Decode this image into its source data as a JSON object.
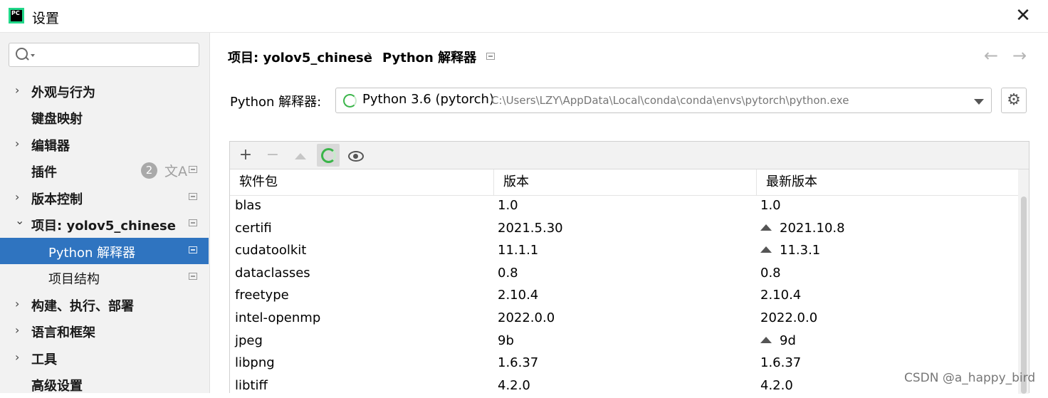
{
  "window": {
    "title": "设置",
    "logo_text": "PC",
    "close_glyph": "✕"
  },
  "sidebar": {
    "search": {
      "value": "",
      "placeholder": ""
    },
    "items": [
      {
        "label": "外观与行为",
        "expandable": true
      },
      {
        "label": "键盘映射",
        "expandable": false
      },
      {
        "label": "编辑器",
        "expandable": true
      },
      {
        "label": "插件",
        "expandable": false,
        "badge": "2"
      },
      {
        "label": "版本控制",
        "expandable": true
      },
      {
        "label": "项目: yolov5_chinese",
        "expandable": true,
        "expanded": true
      },
      {
        "label": "Python 解释器",
        "sub": true,
        "selected": true
      },
      {
        "label": "项目结构",
        "sub": true
      },
      {
        "label": "构建、执行、部署",
        "expandable": true
      },
      {
        "label": "语言和框架",
        "expandable": true
      },
      {
        "label": "工具",
        "expandable": true
      },
      {
        "label": "高级设置",
        "expandable": false
      }
    ],
    "chevron_right": "›",
    "chevron_down": "⌄",
    "translate_glyph": "文A"
  },
  "breadcrumb": {
    "project": "项目: yolov5_chinese",
    "separator": "›",
    "page": "Python 解释器",
    "back_glyph": "←",
    "forward_glyph": "→"
  },
  "interpreter": {
    "label": "Python 解释器:",
    "name": "Python 3.6 (pytorch)",
    "path": "C:\\Users\\LZY\\AppData\\Local\\conda\\conda\\envs\\pytorch\\python.exe",
    "gear_glyph": "⚙"
  },
  "toolbar": {
    "add_glyph": "+",
    "remove_glyph": "−"
  },
  "table": {
    "columns": [
      "软件包",
      "版本",
      "最新版本"
    ],
    "rows": [
      {
        "name": "blas",
        "version": "1.0",
        "latest": "1.0",
        "upgrade": false
      },
      {
        "name": "certifi",
        "version": "2021.5.30",
        "latest": "2021.10.8",
        "upgrade": true
      },
      {
        "name": "cudatoolkit",
        "version": "11.1.1",
        "latest": "11.3.1",
        "upgrade": true
      },
      {
        "name": "dataclasses",
        "version": "0.8",
        "latest": "0.8",
        "upgrade": false
      },
      {
        "name": "freetype",
        "version": "2.10.4",
        "latest": "2.10.4",
        "upgrade": false
      },
      {
        "name": "intel-openmp",
        "version": "2022.0.0",
        "latest": "2022.0.0",
        "upgrade": false
      },
      {
        "name": "jpeg",
        "version": "9b",
        "latest": "9d",
        "upgrade": true
      },
      {
        "name": "libpng",
        "version": "1.6.37",
        "latest": "1.6.37",
        "upgrade": false
      },
      {
        "name": "libtiff",
        "version": "4.2.0",
        "latest": "4.2.0",
        "upgrade": false
      }
    ]
  },
  "watermark": "CSDN @a_happy_bird",
  "colors": {
    "selection": "#2f74c0",
    "sidebar_bg": "#f2f2f2",
    "spinner_green": "#3bb54a",
    "brand_green": "#21d789"
  }
}
